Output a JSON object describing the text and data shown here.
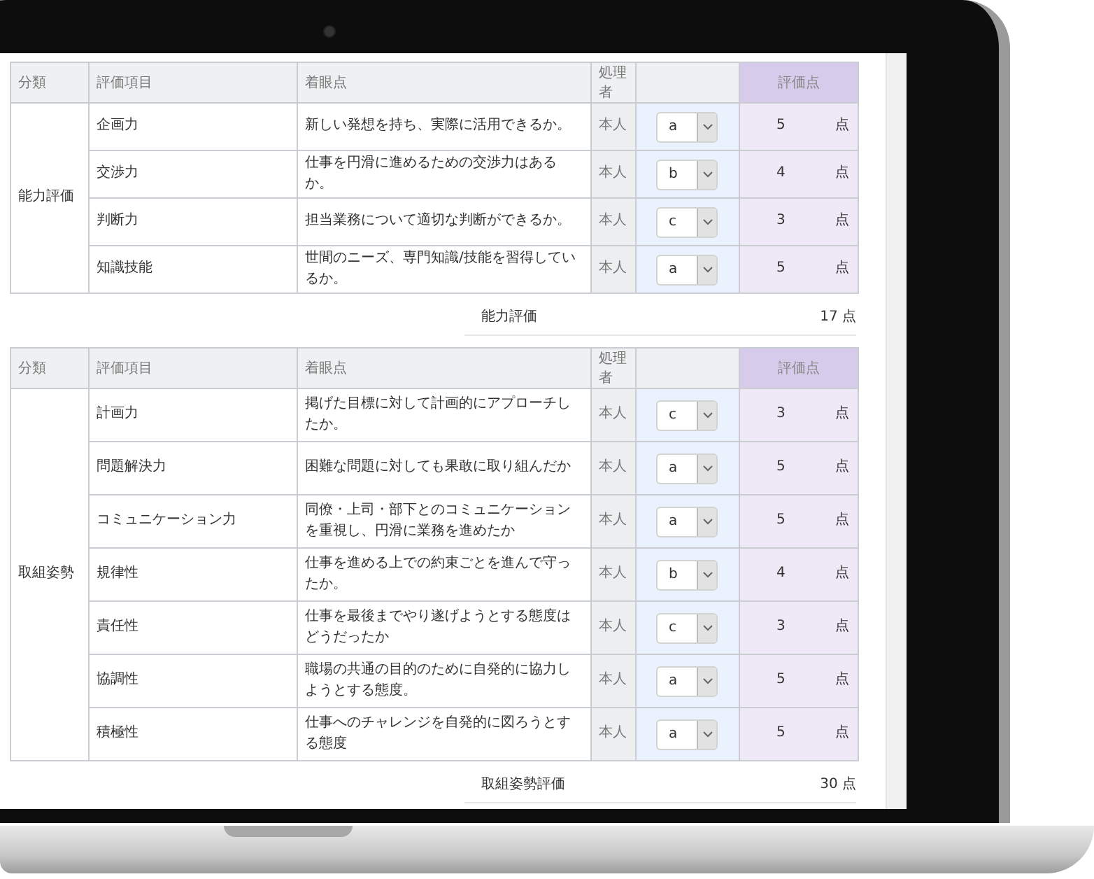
{
  "sections": [
    {
      "headers": {
        "category": "分類",
        "item": "評価項目",
        "point": "着眼点",
        "handler": "処理者",
        "score": "評価点"
      },
      "category": "能力評価",
      "rows": [
        {
          "item": "企画力",
          "point": "新しい発想を持ち、実際に活用できるか。",
          "handler": "本人",
          "grade": "a",
          "score": "5",
          "unit": "点"
        },
        {
          "item": "交渉力",
          "point": "仕事を円滑に進めるための交渉力はあるか。",
          "handler": "本人",
          "grade": "b",
          "score": "4",
          "unit": "点"
        },
        {
          "item": "判断力",
          "point": "担当業務について適切な判断ができるか。",
          "handler": "本人",
          "grade": "c",
          "score": "3",
          "unit": "点"
        },
        {
          "item": "知識技能",
          "point": "世間のニーズ、専門知識/技能を習得しているか。",
          "handler": "本人",
          "grade": "a",
          "score": "5",
          "unit": "点"
        }
      ],
      "summary_label": "能力評価",
      "summary_total": "17 点"
    },
    {
      "headers": {
        "category": "分類",
        "item": "評価項目",
        "point": "着眼点",
        "handler": "処理者",
        "score": "評価点"
      },
      "category": "取組姿勢",
      "rows": [
        {
          "item": "計画力",
          "point": "掲げた目標に対して計画的にアプローチしたか。",
          "handler": "本人",
          "grade": "c",
          "score": "3",
          "unit": "点"
        },
        {
          "item": "問題解決力",
          "point": "困難な問題に対しても果敢に取り組んだか",
          "handler": "本人",
          "grade": "a",
          "score": "5",
          "unit": "点"
        },
        {
          "item": "コミュニケーション力",
          "point": "同僚・上司・部下とのコミュニケーションを重視し、円滑に業務を進めたか",
          "handler": "本人",
          "grade": "a",
          "score": "5",
          "unit": "点"
        },
        {
          "item": "規律性",
          "point": "仕事を進める上での約束ごとを進んで守ったか。",
          "handler": "本人",
          "grade": "b",
          "score": "4",
          "unit": "点"
        },
        {
          "item": "責任性",
          "point": "仕事を最後までやり遂げようとする態度はどうだったか",
          "handler": "本人",
          "grade": "c",
          "score": "3",
          "unit": "点"
        },
        {
          "item": "協調性",
          "point": "職場の共通の目的のために自発的に協力しようとする態度。",
          "handler": "本人",
          "grade": "a",
          "score": "5",
          "unit": "点"
        },
        {
          "item": "積極性",
          "point": "仕事へのチャレンジを自発的に図ろうとする態度",
          "handler": "本人",
          "grade": "a",
          "score": "5",
          "unit": "点"
        }
      ],
      "summary_label": "取組姿勢評価",
      "summary_total": "30 点"
    }
  ]
}
